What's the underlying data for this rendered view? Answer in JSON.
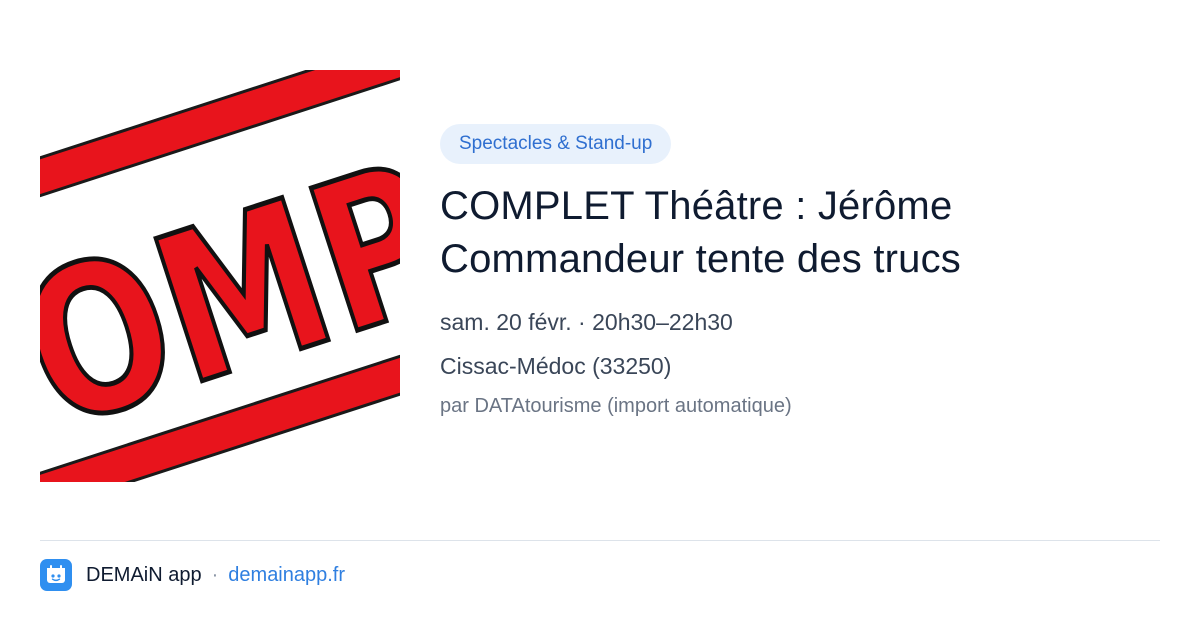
{
  "event": {
    "category": "Spectacles & Stand-up",
    "title_line1": "COMPLET Théâtre : Jérôme",
    "title_line2": "Commandeur tente des trucs",
    "datetime": "sam. 20 févr. · 20h30–22h30",
    "location": "Cissac-Médoc (33250)",
    "source": "par DATAtourisme (import automatique)",
    "image_text": "COMPLET"
  },
  "footer": {
    "app_name": "DEMAiN app",
    "separator": "·",
    "link_text": "demainapp.fr"
  },
  "colors": {
    "accent": "#2f7fe0",
    "badge_bg": "#e8f1fc",
    "stamp_red": "#e8141c"
  }
}
